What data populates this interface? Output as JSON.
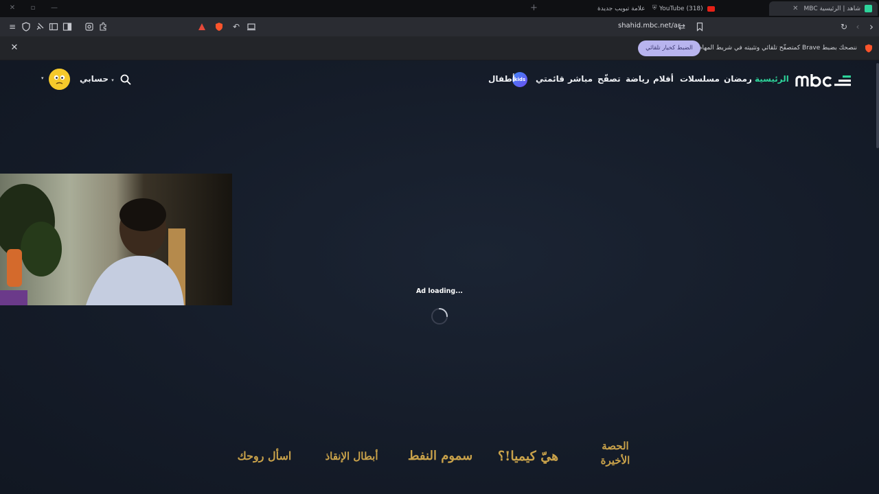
{
  "browser": {
    "tabs": [
      {
        "title": "شاهد | الرئيسية MBC",
        "active": true
      },
      {
        "title": "(318) YouTube",
        "active": false
      },
      {
        "title": "علامة تبويب جديدة",
        "active": false
      }
    ],
    "new_tab_symbol": "+",
    "address": "shahid.mbc.net/ar",
    "icons": [
      "menu-icon",
      "shield-icon",
      "pin-icon",
      "sidebar-icon",
      "panel-icon",
      "screenshot-icon",
      "extensions-icon",
      "brave-rewards-icon",
      "adblock-shield-icon",
      "back-arrow-icon",
      "cast-icon",
      "tune-icon",
      "bookmark-icon",
      "reload-icon",
      "history-back-icon",
      "forward-icon"
    ]
  },
  "notification": {
    "message": "ننصحك بضبط Brave كمتصفّح تلقائي وتثبيته في شريط المهام",
    "button_label": "الضبط كخيار تلقائي",
    "close_symbol": "✕"
  },
  "site": {
    "nav": [
      {
        "label": "الرئيسية",
        "active": true
      },
      {
        "label": "رمضان",
        "active": false
      },
      {
        "label": "مسلسلات",
        "active": false
      },
      {
        "label": "أفلام",
        "active": false
      },
      {
        "label": "رياضة",
        "active": false
      },
      {
        "label": "تصفّح",
        "active": false
      },
      {
        "label": "مباشر",
        "active": false
      },
      {
        "label": "قائمتي",
        "active": false
      },
      {
        "label": "أطفال",
        "active": false
      }
    ],
    "kids_badge": "kids",
    "account_label": "حسابي",
    "ad_loading": "Ad loading...",
    "shows": [
      "الحصة الأخيرة",
      "هيّ كيميا!؟",
      "سموم النفط",
      "أبطال الإنقاذ",
      "اسأل روحك"
    ]
  },
  "colors": {
    "accent": "#2dd39a",
    "page_bg": "#141b28",
    "notif_button": "#b8b4ee",
    "gold": "#c9a24a"
  }
}
